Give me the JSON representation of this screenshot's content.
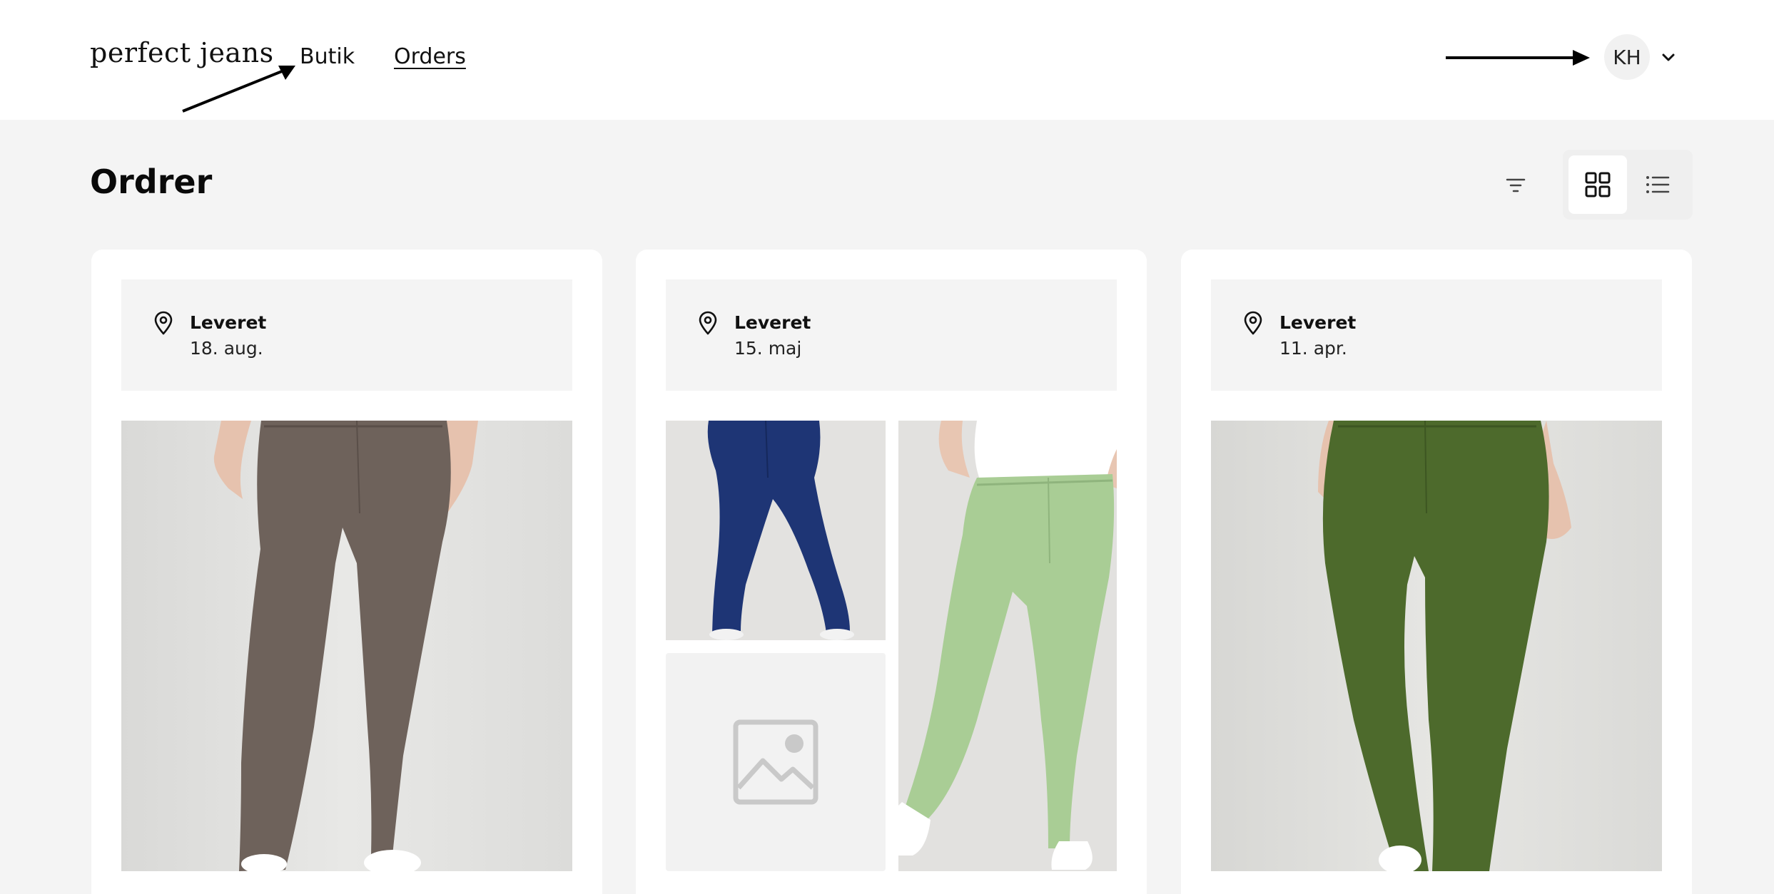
{
  "header": {
    "logo": "perfect jeans",
    "nav": [
      {
        "label": "Butik"
      },
      {
        "label": "Orders"
      }
    ],
    "user": {
      "initials": "KH"
    }
  },
  "page": {
    "title": "Ordrer"
  },
  "toolbar": {
    "icons": [
      "filter-icon",
      "grid-view-icon",
      "list-view-icon"
    ],
    "active_view": "grid"
  },
  "orders": [
    {
      "status": "Leveret",
      "date": "18. aug.",
      "images": [
        "brown-jeans"
      ]
    },
    {
      "status": "Leveret",
      "date": "15. maj",
      "images": [
        "navy-jeans",
        "image-placeholder",
        "mint-green-jeans"
      ]
    },
    {
      "status": "Leveret",
      "date": "11. apr.",
      "images": [
        "olive-green-jeans"
      ]
    }
  ],
  "colors": {
    "page_bg": "#f4f4f4",
    "card_bg": "#ffffff",
    "status_bg": "#f4f4f4",
    "brown_jeans": "#6e625b",
    "navy_jeans": "#1e3575",
    "mint_jeans": "#a9cd95",
    "olive_jeans": "#4d6a2c"
  }
}
